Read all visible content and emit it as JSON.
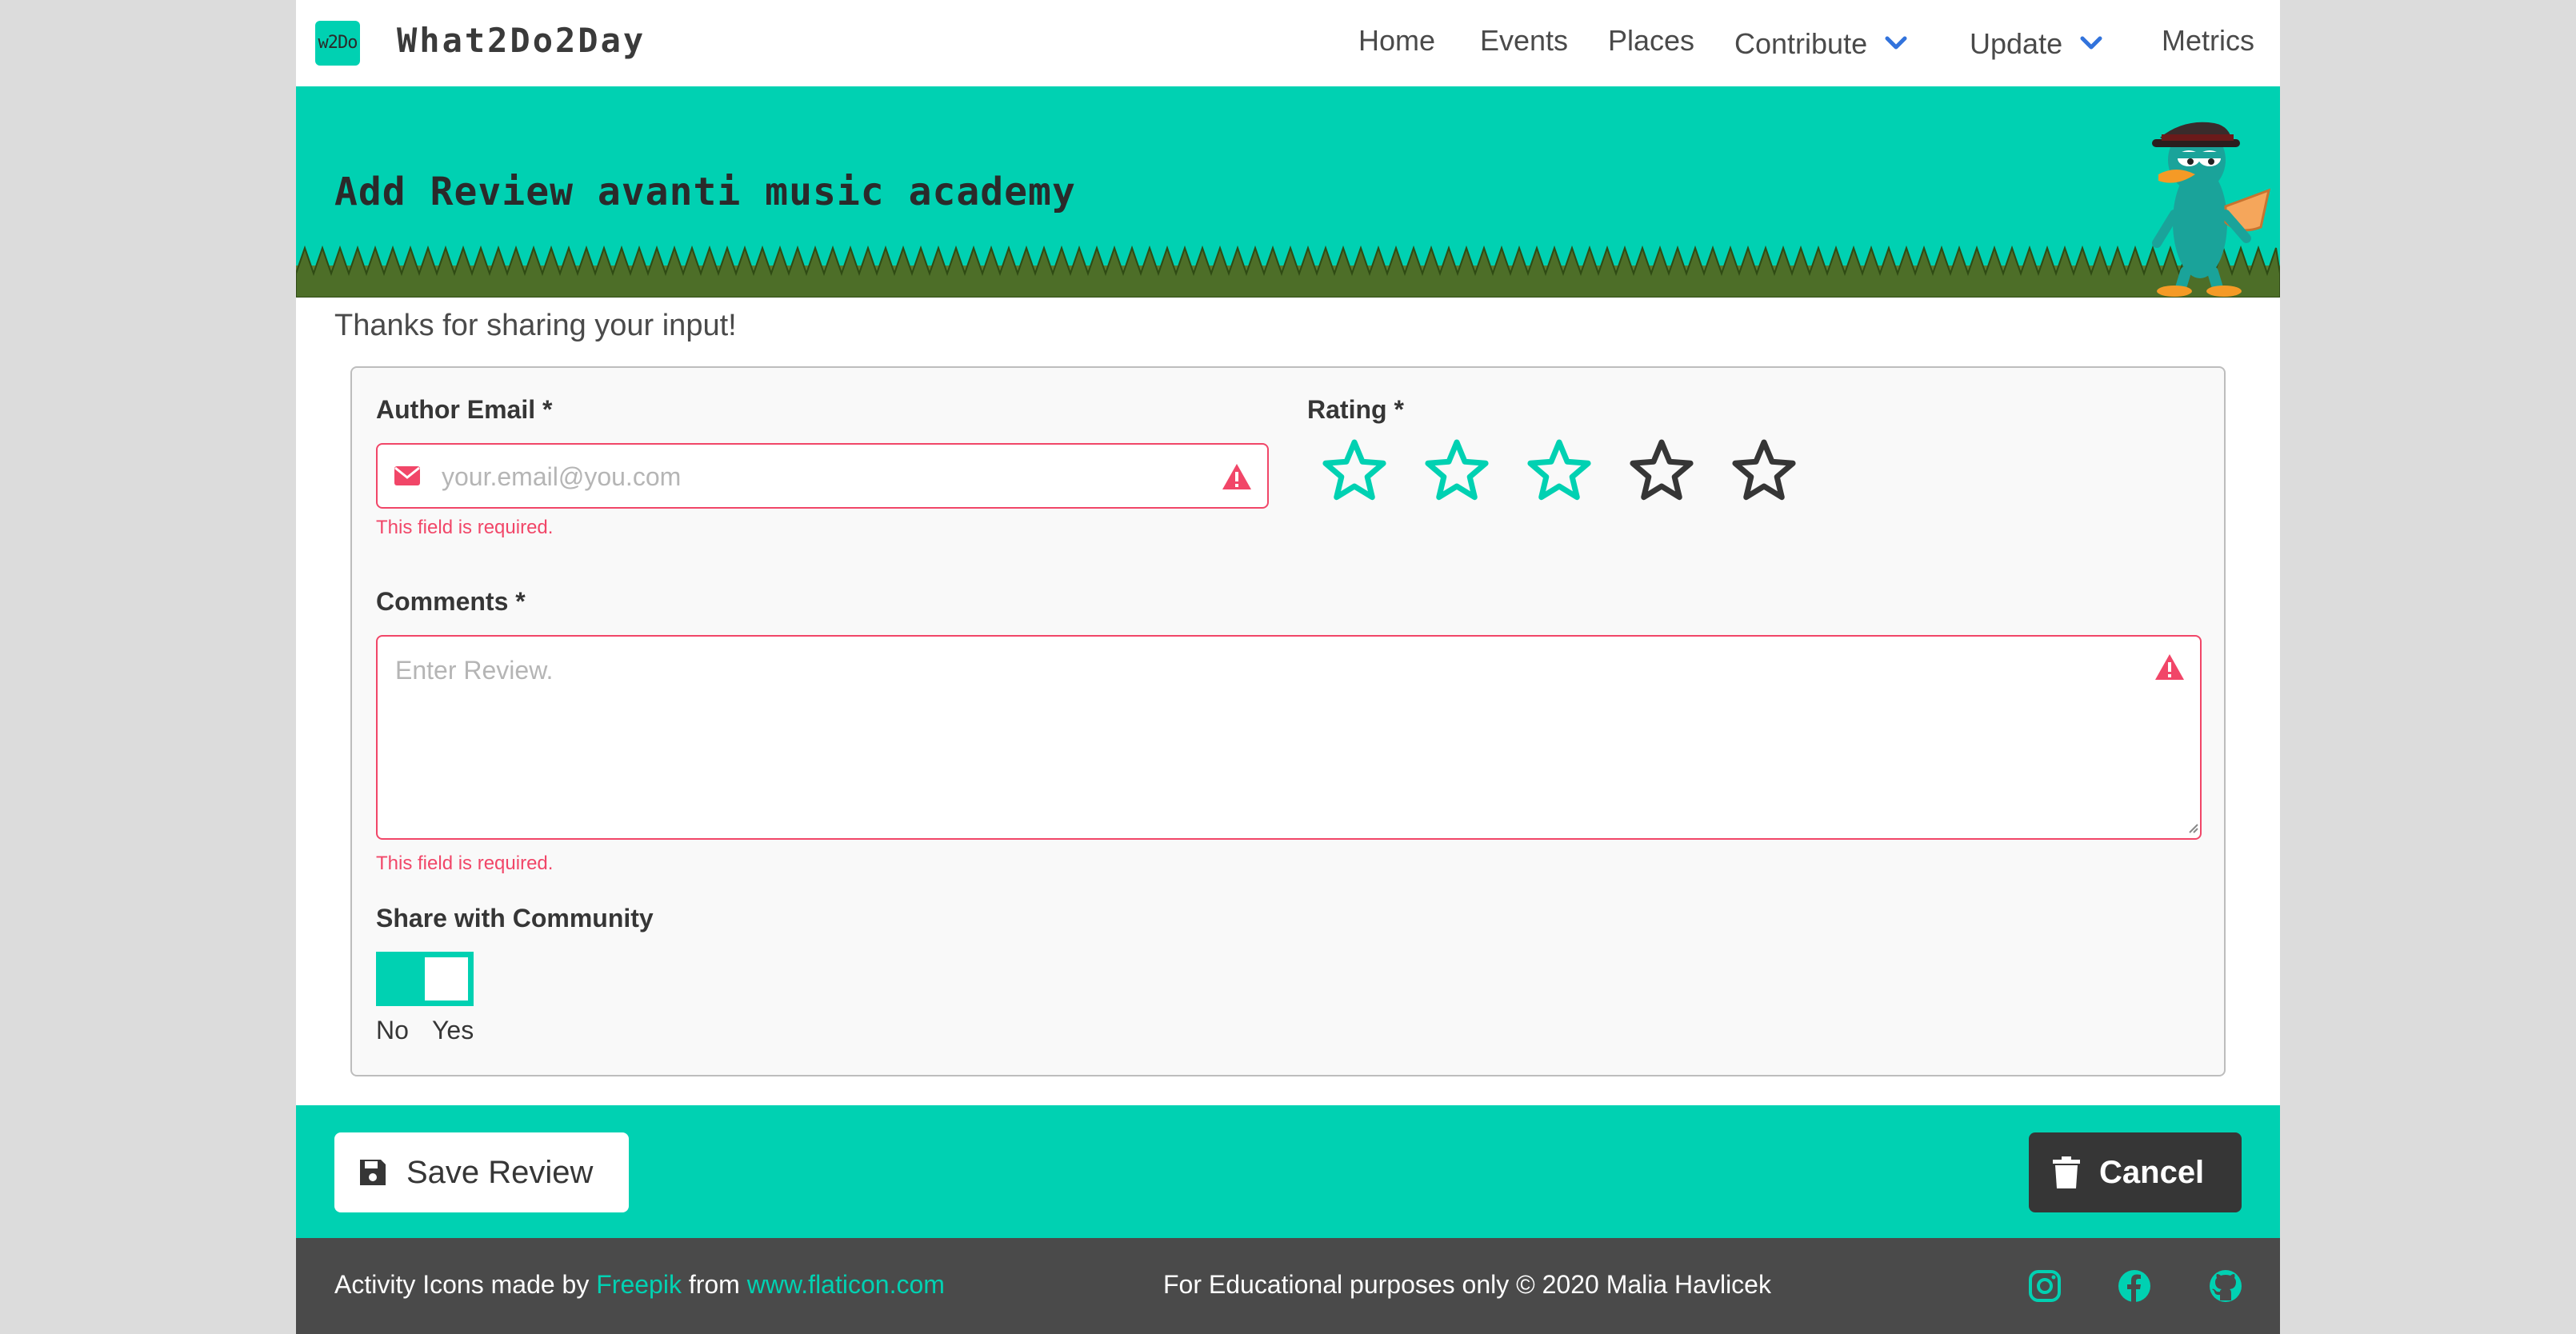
{
  "navbar": {
    "logo_text": "w2Do",
    "brand": "What2Do2Day",
    "items": [
      {
        "label": "Home"
      },
      {
        "label": "Events"
      },
      {
        "label": "Places"
      },
      {
        "label": "Contribute"
      },
      {
        "label": "Update"
      },
      {
        "label": "Metrics"
      }
    ]
  },
  "hero": {
    "title": "Add Review avanti music academy"
  },
  "notice": "Thanks for sharing your input!",
  "form": {
    "email": {
      "label": "Author Email *",
      "placeholder": "your.email@you.com",
      "error": "This field is required."
    },
    "rating": {
      "label": "Rating *",
      "value": 3,
      "max": 5
    },
    "comments": {
      "label": "Comments *",
      "placeholder": "Enter Review.",
      "error": "This field is required."
    },
    "share": {
      "label": "Share with Community",
      "off_label": "No",
      "on_label": "Yes",
      "value": true
    }
  },
  "actions": {
    "save_label": "Save Review",
    "cancel_label": "Cancel"
  },
  "footer": {
    "credit_prefix": "Activity Icons made by",
    "credit_author": "Freepik",
    "credit_mid": "from",
    "credit_site": "www.flaticon.com",
    "notice": "For Educational purposes only © 2020 Malia Havlicek",
    "social": [
      "instagram-icon",
      "facebook-icon",
      "github-icon"
    ]
  },
  "colors": {
    "primary": "#00d1b2",
    "danger": "#f14668",
    "dark": "#363636",
    "footer": "#4a4a4a",
    "link": "#3273dc"
  }
}
